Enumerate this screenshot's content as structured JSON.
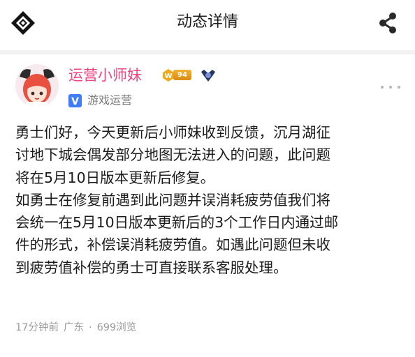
{
  "header": {
    "title": "动态详情",
    "logo_icon": "diamond-logo-icon",
    "share_icon": "share-icon"
  },
  "author": {
    "name": "运营小师妹",
    "level": "94",
    "level_badge_icon": "vip-level-badge-icon",
    "rank_icon": "rank-emblem-icon",
    "verify_icon": "verified-v-icon",
    "verify_mark": "V",
    "role": "游戏运营",
    "name_color": "#f0457f",
    "avatar_icon": "avatar-anime-girl"
  },
  "post": {
    "lines": [
      "勇士们好，今天更新后小师妹收到反馈，沉月湖征",
      "讨地下城会偶发部分地图无法进入的问题，此问题",
      "将在5月10日版本更新后修复。",
      "如勇士在修复前遇到此问题并误消耗疲劳值我们将",
      "会统一在5月10日版本更新后的3个工作日内通过邮",
      "件的形式，补偿误消耗疲劳值。如遇此问题但未收",
      "到疲劳值补偿的勇士可直接联系客服处理。"
    ]
  },
  "meta": {
    "time": "17分钟前",
    "location": "广东",
    "dot": "·",
    "views": "699浏览"
  },
  "menu": {
    "more_icon": "more-dots-icon"
  }
}
